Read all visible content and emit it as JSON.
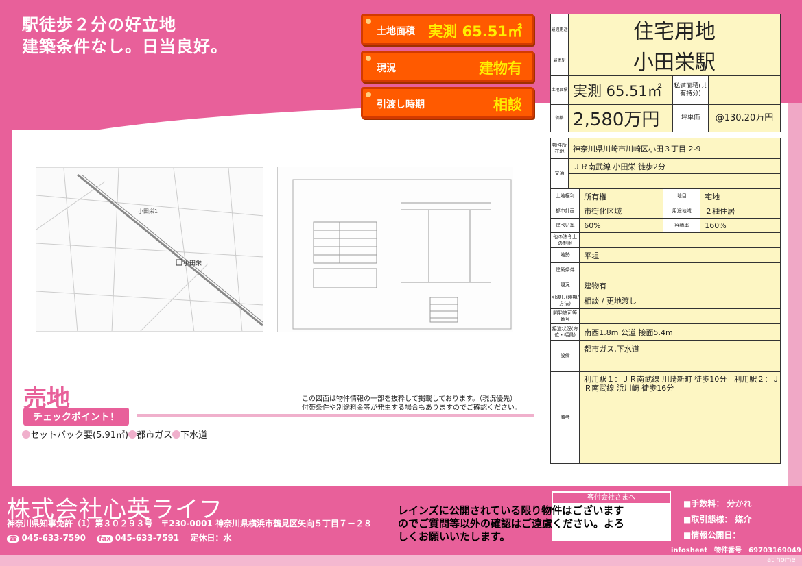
{
  "header": {
    "catch_line1": "駅徒歩２分の好立地",
    "catch_line2": "建築条件なし。日当良好。"
  },
  "badges": [
    {
      "label": "土地面積",
      "value": "実測 65.51㎡"
    },
    {
      "label": "現況",
      "value": "建物有"
    },
    {
      "label": "引渡し時期",
      "value": "相談"
    }
  ],
  "summary": {
    "use_label": "最適用途",
    "use_value": "住宅用地",
    "station_label": "最寄駅",
    "station_value": "小田栄駅",
    "area_label": "土地面積",
    "area_value": "実測 65.51㎡",
    "private_road_label": "私道面積(共有持分)",
    "private_road_value": "",
    "price_label": "価格",
    "price_value": "2,580万円",
    "unit_price_label": "坪単価",
    "unit_price_value": "@130.20万円"
  },
  "details": {
    "address_label": "物件所在地",
    "address": "神奈川県川崎市川崎区小田３丁目 2-9",
    "traffic_label": "交通",
    "traffic": "ＪＲ南武線 小田栄 徒歩2分",
    "rights_label": "土地権利",
    "rights": "所有権",
    "landcat_label": "地目",
    "landcat": "宅地",
    "plan_label": "都市計画",
    "plan": "市街化区域",
    "zone_label": "用途地域",
    "zone": "２種住居",
    "bcr_label": "建ぺい率",
    "bcr": "60%",
    "far_label": "容積率",
    "far": "160%",
    "other_label": "他の法令上の制限",
    "other": "",
    "terrain_label": "地勢",
    "terrain": "平坦",
    "cond_label": "建築条件",
    "cond": "",
    "status_label": "現況",
    "status": "建物有",
    "handover_label": "引渡し(時期/方法)",
    "handover": "相談 / 更地渡し",
    "dev_label": "開発許可等番号",
    "dev": "",
    "road_label": "接道状況(方位・幅員)",
    "road": "南西1.8m 公道 接面5.4m",
    "facility_label": "設備",
    "facility": "都市ガス,下水道",
    "remarks_label": "備考",
    "remarks": "利用駅１：ＪＲ南武線 川崎新町 徒歩10分　利用駅２：ＪＲ南武線 浜川崎 徒歩16分"
  },
  "body": {
    "title": "売地",
    "check_label": "チェックポイント！",
    "points": [
      "セットバック要(5.91㎡)",
      "都市ガス",
      "下水道"
    ],
    "notice1": "この図面は物件情報の一部を抜粋して掲載しております。（現況優先）",
    "notice2": "付帯条件や別途料金等が発生する場合もありますのでご確認ください。"
  },
  "map_labels": {
    "station": "小田栄",
    "station_name": "小田栄1"
  },
  "footer": {
    "company": "株式会社心英ライフ",
    "license": "神奈川県知事免許（1）第３０２９３号",
    "address": "〒230-0001 神奈川県横浜市鶴見区矢向５丁目７－２８",
    "tel_icon": "☎",
    "tel": "045-633-7590",
    "fax_icon": "fax",
    "fax": "045-633-7591",
    "holiday": "定休日：水",
    "reins": "レインズに公開されている限り物件はございますのでご質問等以外の確認はご遠慮ください。よろしくお願いいたします。",
    "box_title": "客付会社さまへ",
    "fee": "■手数料： 分かれ",
    "deal": "■取引態様： 媒介",
    "info_date": "■情報公開日：",
    "infosheet": "infosheet　物件番号　69703169049",
    "athome": "at home"
  }
}
